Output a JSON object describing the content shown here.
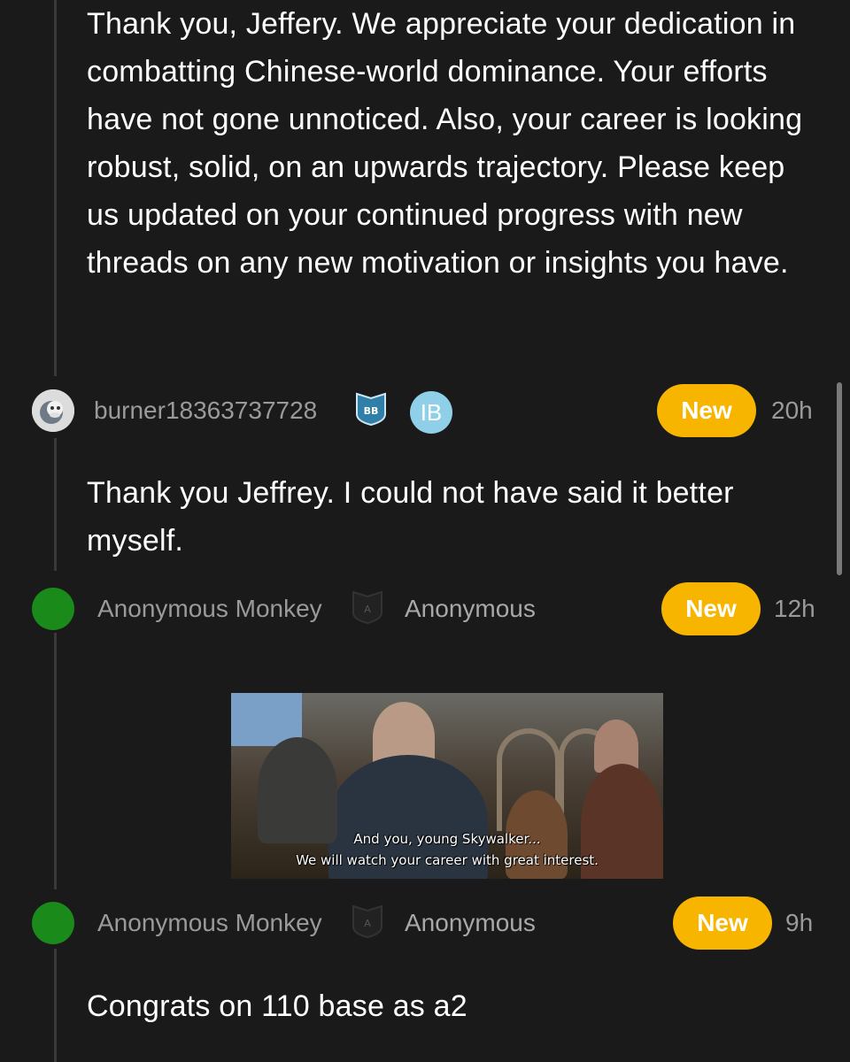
{
  "comments": [
    {
      "text": "Thank you, Jeffery. We appreciate your dedication in combatting Chinese-world dominance. Your efforts have not gone unnoticed. Also, your career is looking robust, solid, on an upwards trajectory. Please keep us updated on your continued progress with new threads on any new motivation or insights you have."
    },
    {
      "username": "burner18363737728",
      "badge": "BB",
      "company": "IB",
      "new_label": "New",
      "time": "20h",
      "text": "Thank you Jeffrey. I could not have said it better myself."
    },
    {
      "username": "Anonymous Monkey",
      "badge": "A",
      "company": "Anonymous",
      "new_label": "New",
      "time": "12h",
      "gif_caption_line1": "And you, young Skywalker...",
      "gif_caption_line2": "We will watch your career with great interest."
    },
    {
      "username": "Anonymous Monkey",
      "badge": "A",
      "company": "Anonymous",
      "new_label": "New",
      "time": "9h",
      "text": "Congrats on 110 base as a2"
    }
  ],
  "colors": {
    "background": "#1a1a1a",
    "new_pill": "#f7b500",
    "ib_badge": "#8fd0e8",
    "bb_badge": "#2f7fa8",
    "anon_avatar": "#1a8a1a",
    "muted_text": "#9a9a9a"
  },
  "icons": {
    "burner_avatar": "monkey-avatar-icon",
    "bb_badge": "shield-badge-icon",
    "anon_badge": "shield-badge-icon"
  }
}
